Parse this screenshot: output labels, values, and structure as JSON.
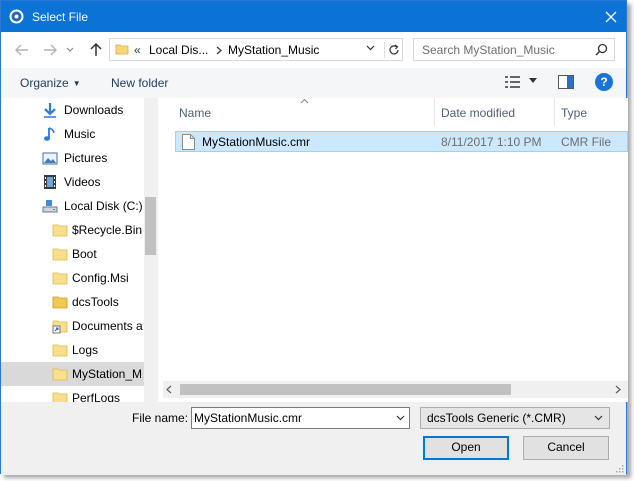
{
  "window": {
    "title": "Select File"
  },
  "address": {
    "overflow": "«",
    "crumbs": [
      "Local Dis...",
      "MyStation_Music"
    ]
  },
  "search": {
    "placeholder": "Search MyStation_Music"
  },
  "toolbar": {
    "organize": "Organize",
    "new_folder": "New folder",
    "help": "?"
  },
  "nav": {
    "items": [
      {
        "label": "Downloads",
        "icon": "download-arrow-icon"
      },
      {
        "label": "Music",
        "icon": "music-note-icon"
      },
      {
        "label": "Pictures",
        "icon": "pictures-icon"
      },
      {
        "label": "Videos",
        "icon": "film-icon"
      },
      {
        "label": "Local Disk (C:)",
        "icon": "drive-icon"
      },
      {
        "label": "$Recycle.Bin",
        "icon": "folder-icon"
      },
      {
        "label": "Boot",
        "icon": "folder-icon"
      },
      {
        "label": "Config.Msi",
        "icon": "folder-icon"
      },
      {
        "label": "dcsTools",
        "icon": "folder-icon"
      },
      {
        "label": "Documents a",
        "icon": "folder-shortcut-icon"
      },
      {
        "label": "Logs",
        "icon": "folder-icon"
      },
      {
        "label": "MyStation_M",
        "icon": "folder-icon",
        "selected": true
      },
      {
        "label": "PerfLogs",
        "icon": "folder-icon"
      }
    ]
  },
  "columns": {
    "name": "Name",
    "date": "Date modified",
    "type": "Type"
  },
  "files": [
    {
      "name": "MyStationMusic.cmr",
      "date": "8/11/2017 1:10 PM",
      "type": "CMR File"
    }
  ],
  "bottom": {
    "filename_label": "File name:",
    "filename_value": "MyStationMusic.cmr",
    "filter": "dcsTools Generic (*.CMR)",
    "open": "Open",
    "cancel": "Cancel"
  },
  "colors": {
    "title_bar": "#0b72d6",
    "selection": "#cce8ff",
    "accent": "#0078d7"
  }
}
